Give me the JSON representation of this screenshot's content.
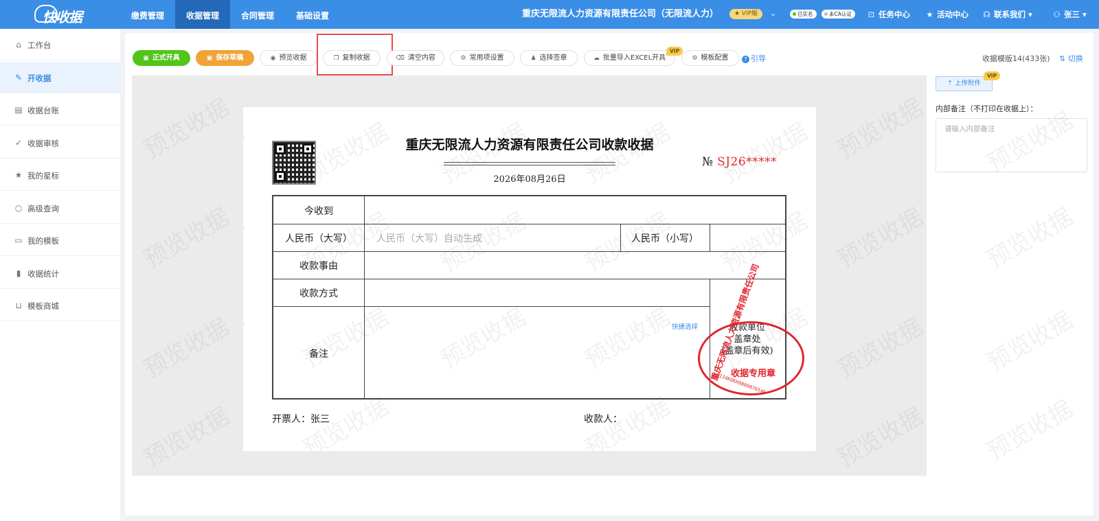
{
  "topbar": {
    "logo_text": "快收据",
    "nav": [
      {
        "label": "缴费管理"
      },
      {
        "label": "收据管理"
      },
      {
        "label": "合同管理"
      },
      {
        "label": "基础设置"
      }
    ],
    "company": "重庆无限流人力资源有限责任公司（无限流人力）",
    "vip": "★ VIP版",
    "verified": "已实名",
    "ca": "未CA认证",
    "links": {
      "tasks": "任务中心",
      "activity": "活动中心",
      "contact": "联系我们",
      "user": "张三"
    }
  },
  "sidebar": {
    "items": [
      {
        "label": "工作台",
        "icon": "home-icon"
      },
      {
        "label": "开收据",
        "icon": "edit-icon"
      },
      {
        "label": "收据台账",
        "icon": "document-icon"
      },
      {
        "label": "收据审核",
        "icon": "check-circle-icon"
      },
      {
        "label": "我的星标",
        "icon": "star-icon"
      },
      {
        "label": "高级查询",
        "icon": "search-icon"
      },
      {
        "label": "我的模板",
        "icon": "clipboard-icon"
      },
      {
        "label": "收据统计",
        "icon": "bar-chart-icon"
      },
      {
        "label": "模板商城",
        "icon": "cart-icon"
      }
    ]
  },
  "toolbar": {
    "issue": "正式开具",
    "save": "保存草稿",
    "preview": "预览收据",
    "copy": "复制收据",
    "clear": "清空内容",
    "common": "常用项设置",
    "sign": "选择签章",
    "excel": "批量导入EXCEL开具",
    "excel_vip": "VIP",
    "tpl_config": "模板配置",
    "guide": "引导",
    "template_info": "收据模版14(433张)",
    "switch": "切换"
  },
  "receipt": {
    "title": "重庆无限流人力资源有限责任公司收款收据",
    "date": "2026年08月26日",
    "no_label": "№",
    "no_value": "SJ26*****",
    "labels": {
      "received_from": "今收到",
      "rmb_upper": "人民币（大写）",
      "rmb_upper_placeholder": "人民币（大写）自动生成",
      "rmb_lower": "人民币（小写）",
      "reason": "收款事由",
      "method": "收款方式",
      "remark": "备注",
      "quick_select": "快捷选择",
      "unit_line1": "收款单位",
      "unit_line2": "盖章处",
      "unit_line3": "(盖章后有效)"
    },
    "seal": {
      "ring_text": "重庆无限流人力资源有限责任公司",
      "label": "收据专用章",
      "code": "9134KOKH9809876546"
    },
    "issuer": "开票人：张三",
    "payee": "收款人：",
    "watermark": "预览收据"
  },
  "right_panel": {
    "upload": "上传附件",
    "upload_vip": "VIP",
    "note_label": "内部备注（不打印在收据上）：",
    "note_placeholder": "请输入内部备注"
  },
  "colors": {
    "primary": "#3a8ee6",
    "green": "#52c41a",
    "orange": "#f0a336",
    "seal_red": "#e0262e",
    "number_red": "#e0302f"
  }
}
